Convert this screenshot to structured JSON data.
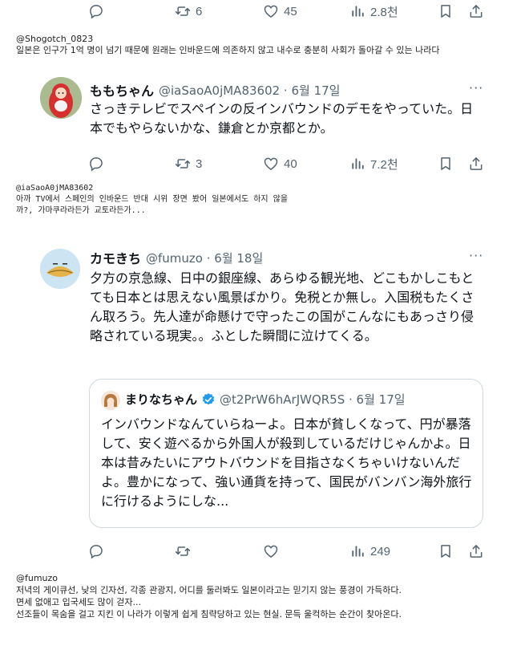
{
  "top_actions": {
    "reply": "",
    "retweet": "6",
    "like": "45",
    "views": "2.8천"
  },
  "note1": {
    "handle": "@Shogotch_0823",
    "text": "일본은 인구가 1억 명이 넘기 때문에 원래는 인바운드에 의존하지 않고 내수로 충분히 사회가 돌아갈 수 있는 나라다"
  },
  "tweet1": {
    "name": "ももちゃん",
    "handle": "@iaSaoA0jMA83602 · 6월 17일",
    "more": "···",
    "text": "さっきテレビでスペインの反インバウンドのデモをやっていた。日本でもやらないかな、鎌倉とか京都とか。",
    "actions": {
      "reply": "",
      "retweet": "3",
      "like": "40",
      "views": "7.2천"
    }
  },
  "note2": {
    "handle": "@iaSaoA0jMA83602",
    "text": "아까 TV에서 스페인의 인바운드 반대 시위 장면 봤어 일본에서도 하지 않을까?, 가마쿠라라든가 교토라든가..."
  },
  "tweet2": {
    "name": "カモきち",
    "handle": "@fumuzo · 6월 18일",
    "more": "···",
    "text": "夕方の京急線、日中の銀座線、あらゆる観光地、どこもかしこもとても日本とは思えない風景ばかり。免税とか無し。入国税もたくさん取ろう。先人達が命懸けで守ったこの国がこんなにもあっさり侵略されている現実。。ふとした瞬間に泣けてくる。",
    "quote": {
      "name": "まりなちゃん",
      "handle": "@t2PrW6hArJWQR5S · 6월 17일",
      "text": "インバウンドなんていらねーよ。日本が貧しくなって、円が暴落して、安く遊べるから外国人が殺到しているだけじゃんかよ。日本は昔みたいにアウトバウンドを目指さなくちゃいけないんだよ。豊かになって、強い通貨を持って、国民がバンバン海外旅行に行けるようにしな..."
    },
    "actions": {
      "reply": "",
      "retweet": "",
      "like": "",
      "views": "249"
    }
  },
  "note3": {
    "handle": "@fumuzo",
    "lines": [
      "저녁의 게이큐선, 낮의 긴자선, 각종 관광지, 어디를 둘러봐도 일본이라고는 믿기지 않는 풍경이 가득하다.",
      "면세 없애고 입국세도 많이 걷자...",
      "선조들이 목숨을 걸고 지킨 이 나라가 이렇게 쉽게 침략당하고 있는 현실. 문득 울컥하는 순간이 찾아온다."
    ]
  },
  "colors": {
    "text": "#0f1419",
    "muted": "#536471",
    "verified": "#1d9bf0",
    "border": "#cfd9de"
  }
}
